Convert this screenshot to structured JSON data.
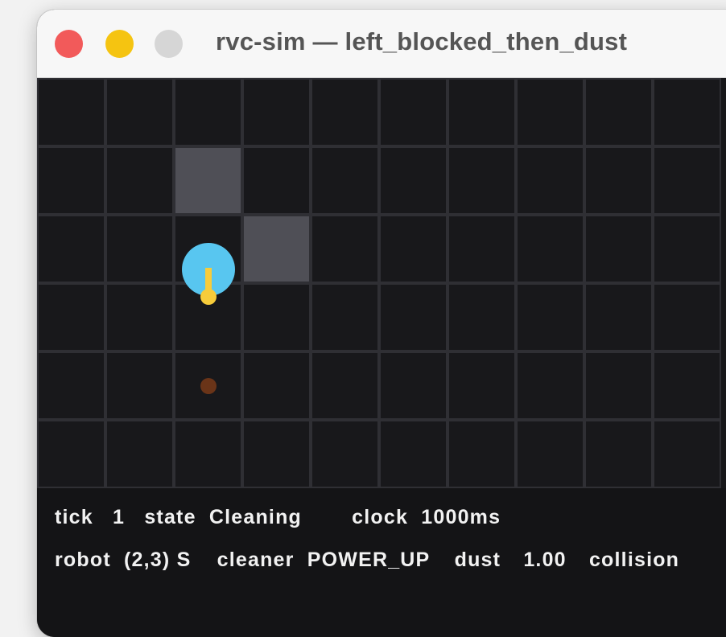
{
  "window": {
    "title": "rvc-sim — left_blocked_then_dust",
    "controls": [
      "close",
      "minimize",
      "zoom"
    ]
  },
  "grid": {
    "columns": 10,
    "rows": 6,
    "obstacles": [
      [
        2,
        1
      ],
      [
        3,
        2
      ]
    ],
    "robot": {
      "cell": [
        2,
        3
      ],
      "heading": "S",
      "color": "#58c6f0"
    },
    "dust": [
      [
        2,
        4
      ]
    ],
    "colors": {
      "cell": "#18181b",
      "grid_line": "#2f2f34",
      "obstacle": "#4f4f56",
      "heading": "#f7cc3b",
      "dust": "#6a3418"
    }
  },
  "status": {
    "line1": {
      "tick_label": "tick",
      "tick_value": "1",
      "state_label": "state",
      "state_value": "Cleaning",
      "clock_label": "clock",
      "clock_value": "1000ms"
    },
    "line2": {
      "robot_label": "robot",
      "robot_value": "(2,3) S",
      "cleaner_label": "cleaner",
      "cleaner_value": "POWER_UP",
      "dust_label": "dust",
      "dust_value": "1.00",
      "collision_label": "collision"
    }
  }
}
